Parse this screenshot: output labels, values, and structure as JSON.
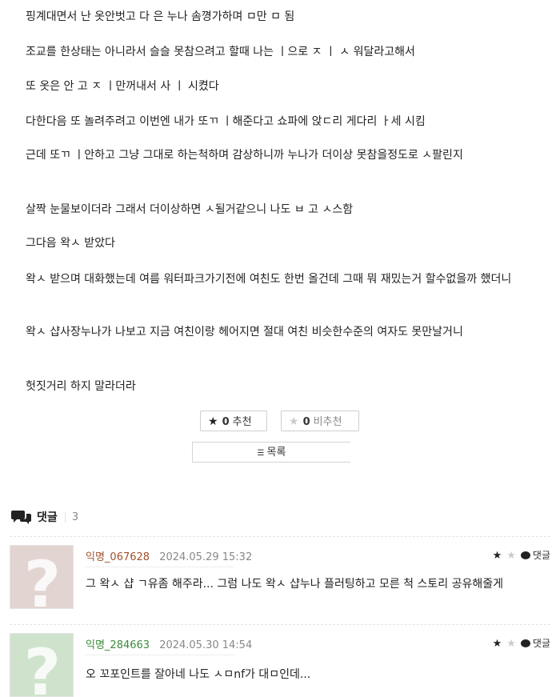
{
  "post": {
    "paragraphs": [
      "핑계대면서 난 옷안벗고 다 은 누나 솜꼉가하며 ㅁ만 ㅁ 됨",
      "조교를 한상태는 아니라서 슬슬 못참으려고 할때 나는 ㅣ으로 ㅈ ㅣ ㅅ 워달라고해서",
      "또 옷은 안 고 ㅈ ㅣ만꺼내서 사 ㅣ 시켰다",
      "다한다음 또 놀려주려고 이번엔 내가 또ㄲ ㅣ해준다고 쇼파에 앉ㄷ리 게다리 ㅏ세 시킴",
      "근데 또ㄲ ㅣ안하고 그냥 그대로 하는척하며 감상하니까 누나가 더이상 못참을정도로 ㅅ팔린지",
      "살짝 눈물보이더라 그래서 더이상하면 ㅅ될거같으니 나도 ㅂ 고 ㅅ스함",
      "그다음 왁ㅅ 받았다",
      "왁ㅅ 받으며 대화했는데 여름 워터파크가기전에 여친도 한번 올건데 그때 뭐 재밌는거 할수없을까 했더니",
      "왁ㅅ 샵사장누나가 나보고 지금 여친이랑 헤어지면 절대 여친 비슷한수준의 여자도 못만날거니",
      "헛짓거리 하지 말라더라"
    ]
  },
  "votes": {
    "up_icon": "star-icon",
    "up_count": "0",
    "up_label": "추천",
    "down_count": "0",
    "down_label": "비추천"
  },
  "list_button": {
    "icon": "list-icon",
    "label": "목록"
  },
  "comments_header": {
    "label": "댓글",
    "count": "3"
  },
  "comments": [
    {
      "author": "익명_067628",
      "author_color": "#a0522d",
      "date": "2024.05.29 15:32",
      "reply_label": "댓글",
      "avatar_color": "#e2d4d1",
      "body": "그 왁ㅅ 샵 ㄱ유좀 해주라... 그럼 나도 왁ㅅ 샵누나 플러팅하고 모른 척 스토리 공유해줄게"
    },
    {
      "author": "익명_284663",
      "author_color": "#3a8a3a",
      "date": "2024.05.30 14:54",
      "reply_label": "댓글",
      "avatar_color": "#cfe3cc",
      "body": "오 꼬포인트를 잘아네 나도 ㅅㅁnf가 대ㅁ인데..."
    }
  ],
  "colors": {
    "link_brown": "#a0522d",
    "link_green": "#3a8a3a",
    "border": "#cfcfcf"
  }
}
